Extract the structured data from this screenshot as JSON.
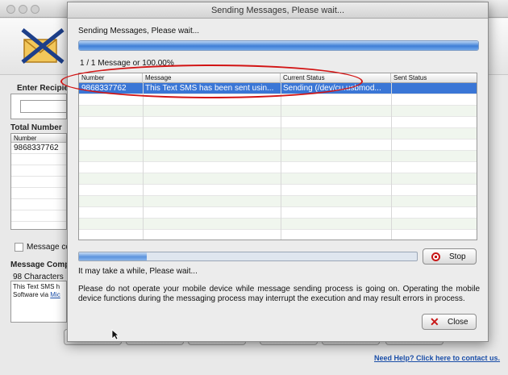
{
  "background": {
    "recipient_label": "Enter Recipien",
    "total_numbers_label": "Total Number",
    "numbers_table": {
      "header": "Number",
      "rows": [
        "9868337762"
      ]
    },
    "message_checkbox_label": "Message co",
    "message_composer_label": "Message Comp",
    "characters_label": "98 Characters",
    "message_preview": "This Text SMS h",
    "message_preview_line2": "Software via ",
    "message_preview_link": "Mic",
    "help_link": "Need Help? Click here to contact us."
  },
  "dialog": {
    "title": "Sending Messages, Please wait...",
    "heading": "Sending Messages, Please wait...",
    "overall_progress_fraction": 1.0,
    "progress_text": "1 / 1 Message or 100.00%",
    "table": {
      "columns": [
        "Number",
        "Message",
        "Current Status",
        "Sent Status"
      ],
      "rows": [
        {
          "number": "9868337762",
          "message": "This Text SMS has been sent usin...",
          "current_status": "Sending (/dev/cu.usbmod...",
          "sent_status": ""
        }
      ]
    },
    "current_progress_fraction": 0.2,
    "stop_label": "Stop",
    "wait_text": "It may take a while, Please wait...",
    "warning_text": "Please do not operate your mobile device while message sending process is going on. Operating the mobile device functions during the messaging process may interrupt the execution and may result errors in process.",
    "close_label": "Close"
  },
  "colors": {
    "accent": "#3a76d6",
    "annotation": "#d21414",
    "stop_icon": "#c81818"
  }
}
